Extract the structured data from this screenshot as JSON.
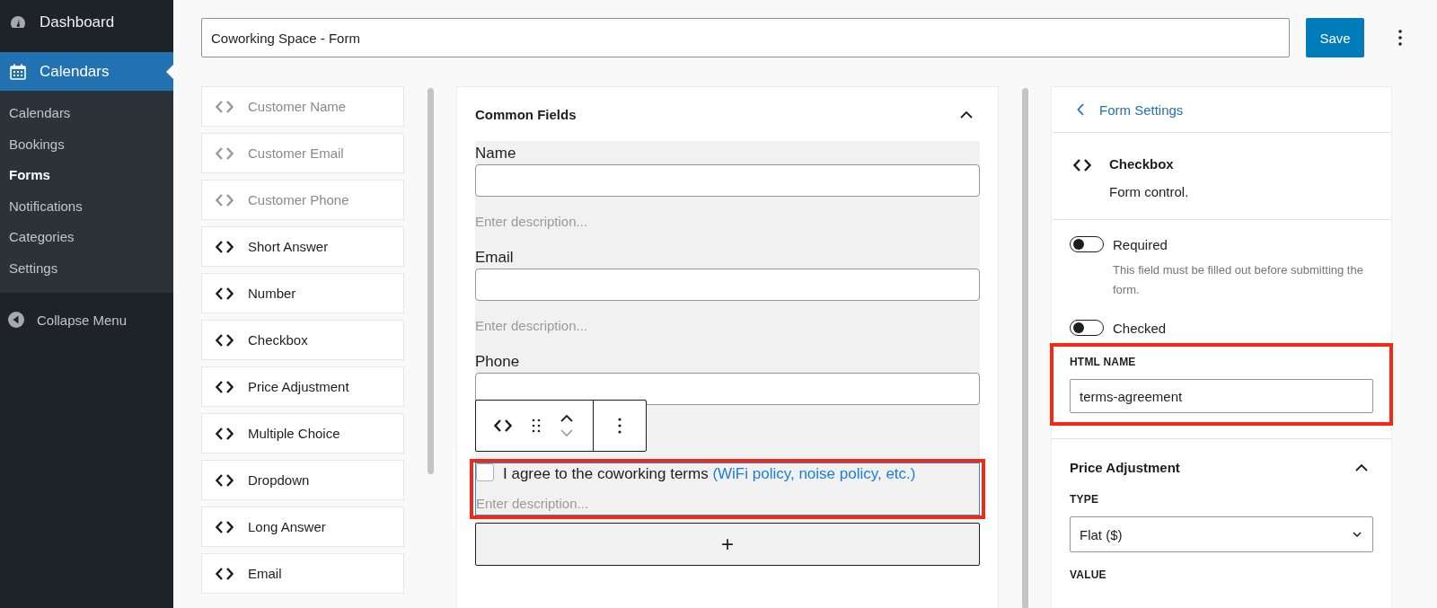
{
  "sidebar": {
    "items": [
      {
        "label": "Dashboard",
        "selected": false
      },
      {
        "label": "Calendars",
        "selected": true
      }
    ],
    "submenu": [
      {
        "label": "Calendars",
        "selected": false
      },
      {
        "label": "Bookings",
        "selected": false
      },
      {
        "label": "Forms",
        "selected": true
      },
      {
        "label": "Notifications",
        "selected": false
      },
      {
        "label": "Categories",
        "selected": false
      },
      {
        "label": "Settings",
        "selected": false
      }
    ],
    "collapse": "Collapse Menu"
  },
  "title_field": {
    "value": "Coworking Space - Form"
  },
  "save_button": "Save",
  "blocks": [
    {
      "label": "Customer Name",
      "disabled": true
    },
    {
      "label": "Customer Email",
      "disabled": true
    },
    {
      "label": "Customer Phone",
      "disabled": true
    },
    {
      "label": "Short Answer",
      "disabled": false
    },
    {
      "label": "Number",
      "disabled": false
    },
    {
      "label": "Checkbox",
      "disabled": false
    },
    {
      "label": "Price Adjustment",
      "disabled": false
    },
    {
      "label": "Multiple Choice",
      "disabled": false
    },
    {
      "label": "Dropdown",
      "disabled": false
    },
    {
      "label": "Long Answer",
      "disabled": false
    },
    {
      "label": "Email",
      "disabled": false
    }
  ],
  "common_fields": {
    "title": "Common Fields",
    "expanded": true,
    "fields": [
      {
        "kind": "text",
        "label": "Name",
        "description_placeholder": "Enter description...",
        "selected": false,
        "highlighted": false
      },
      {
        "kind": "text",
        "label": "Email",
        "description_placeholder": "Enter description...",
        "selected": false,
        "highlighted": false
      },
      {
        "kind": "text",
        "label": "Phone",
        "selected": false,
        "highlighted": false
      },
      {
        "kind": "checkbox",
        "label": "I agree to the coworking terms",
        "hint": "(WiFi policy, noise policy, etc.)",
        "checked": false,
        "description_placeholder": "Enter description...",
        "selected": true,
        "highlighted": true
      }
    ],
    "add_button": "+"
  },
  "settings": {
    "back": "Form Settings",
    "block_title": "Checkbox",
    "block_description": "Form control.",
    "toggles": [
      {
        "label": "Required",
        "on": false,
        "help": "This field must be filled out before submitting the form."
      },
      {
        "label": "Checked",
        "on": false
      }
    ],
    "html_name": {
      "label": "HTML NAME",
      "value": "terms-agreement",
      "highlighted": true
    },
    "price": {
      "title": "Price Adjustment",
      "expanded": true,
      "type_label": "TYPE",
      "type_value": "Flat ($)",
      "value_label": "VALUE"
    }
  }
}
